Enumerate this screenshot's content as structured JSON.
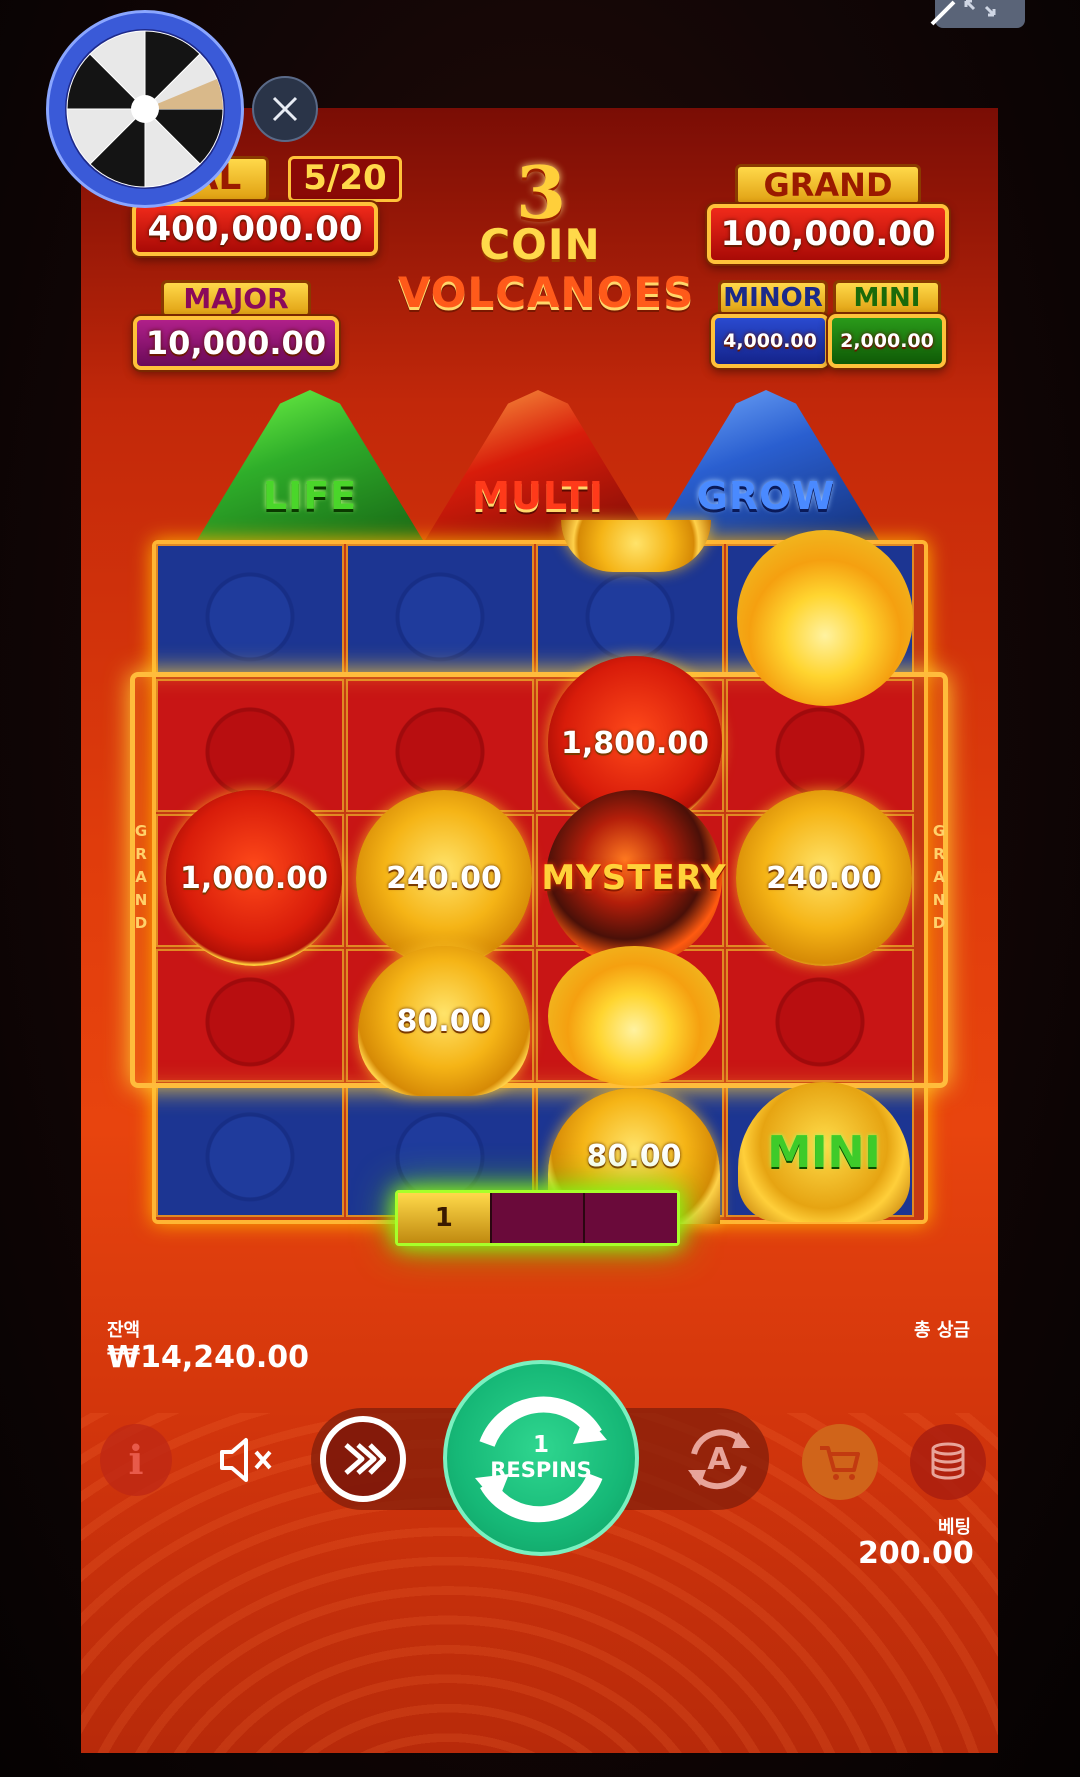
{
  "jackpots": {
    "total": {
      "label": "TAL",
      "counter": "5/20",
      "value": "400,000.00"
    },
    "grand": {
      "label": "GRAND",
      "value": "100,000.00"
    },
    "major": {
      "label": "MAJOR",
      "value": "10,000.00"
    },
    "minor": {
      "label": "MINOR",
      "value": "4,000.00"
    },
    "mini": {
      "label": "MINI",
      "value": "2,000.00"
    }
  },
  "logo": {
    "number": "3",
    "line1": "COIN",
    "line2": "VOLCANOES"
  },
  "volcanoes": [
    {
      "label": "LIFE",
      "color": "#2fae2a"
    },
    {
      "label": "MULTI",
      "color": "#d81c0a"
    },
    {
      "label": "GROW",
      "color": "#2a5fd0"
    }
  ],
  "grid": {
    "side_label": "GRAND",
    "coins": {
      "r1c4_fire": "",
      "r2c3": "1,800.00",
      "r3c1": "1,000.00",
      "r3c2": "240.00",
      "r3c3": "MYSTERY",
      "r3c4": "240.00",
      "r4c2": "80.00",
      "r5c3": "80.00",
      "r5c4": "MINI"
    }
  },
  "respin_progress": {
    "active": "1",
    "filled_segments": 1,
    "total_segments": 3
  },
  "status": {
    "balance_label": "잔액",
    "balance_value": "₩14,240.00",
    "total_win_label": "총 상금",
    "bet_label": "베팅",
    "bet_value": "200.00"
  },
  "controls": {
    "spin_count": "1",
    "spin_label": "RESPINS",
    "info_glyph": "i",
    "auto_glyph": "A"
  },
  "icons": [
    "wheel-icon",
    "close-icon",
    "fullscreen-icon",
    "info-icon",
    "mute-icon",
    "turbo-icon",
    "respin-icon",
    "autoplay-icon",
    "shop-icon",
    "coins-stack-icon"
  ],
  "colors": {
    "accent_green": "#16b877",
    "gold": "#ffc23a",
    "board_red": "#c81515",
    "board_blue": "#1c3592"
  }
}
